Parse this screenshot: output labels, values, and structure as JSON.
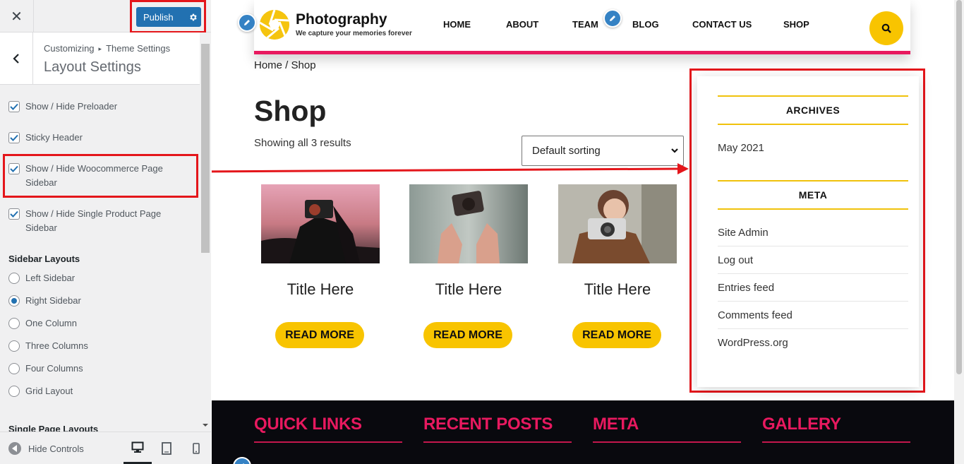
{
  "customizer": {
    "close_icon": "close-icon",
    "publish_label": "Publish",
    "breadcrumb_root": "Customizing",
    "breadcrumb_sep": "▸",
    "breadcrumb_parent": "Theme Settings",
    "section_title": "Layout Settings",
    "checkboxes": [
      {
        "label": "Show / Hide Preloader",
        "checked": true
      },
      {
        "label": "Sticky Header",
        "checked": true
      },
      {
        "label": "Show / Hide Woocommerce Page Sidebar",
        "checked": true
      },
      {
        "label": "Show / Hide Single Product Page Sidebar",
        "checked": true
      }
    ],
    "sidebar_layouts_title": "Sidebar Layouts",
    "sidebar_layouts": [
      {
        "label": "Left Sidebar",
        "selected": false
      },
      {
        "label": "Right Sidebar",
        "selected": true
      },
      {
        "label": "One Column",
        "selected": false
      },
      {
        "label": "Three Columns",
        "selected": false
      },
      {
        "label": "Four Columns",
        "selected": false
      },
      {
        "label": "Grid Layout",
        "selected": false
      }
    ],
    "single_page_layouts_title": "Single Page Layouts",
    "hide_controls_label": "Hide Controls",
    "devices": [
      "desktop-icon",
      "tablet-icon",
      "mobile-icon"
    ],
    "accent_color": "#2271b1",
    "highlight_color": "#e4161b"
  },
  "site": {
    "brand": "Photography",
    "tagline": "We capture your memories forever",
    "nav": [
      "HOME",
      "ABOUT",
      "TEAM",
      "BLOG",
      "CONTACT US",
      "SHOP"
    ],
    "breadcrumb": "Home / Shop",
    "page_title": "Shop",
    "result_count": "Showing all 3 results",
    "sort_selected": "Default sorting",
    "products": [
      {
        "title": "Title Here",
        "button": "READ MORE"
      },
      {
        "title": "Title Here",
        "button": "READ MORE"
      },
      {
        "title": "Title Here",
        "button": "READ MORE"
      }
    ],
    "sidebar": {
      "archives_title": "ARCHIVES",
      "archives": [
        "May 2021"
      ],
      "meta_title": "META",
      "meta_links": [
        "Site Admin",
        "Log out",
        "Entries feed",
        "Comments feed",
        "WordPress.org"
      ]
    },
    "footer": [
      "QUICK LINKS",
      "RECENT POSTS",
      "META",
      "GALLERY"
    ],
    "brand_yellow": "#f8c400",
    "brand_pink": "#e8195f"
  }
}
